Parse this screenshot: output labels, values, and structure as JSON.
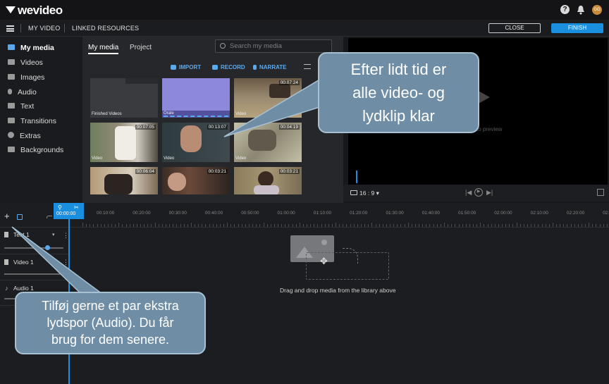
{
  "app": {
    "logo": "wevideo",
    "help_icon": "?",
    "avatar_initials": "GG"
  },
  "nav": {
    "my_video": "MY VIDEO",
    "linked_resources": "LINKED RESOURCES",
    "close": "CLOSE",
    "finish": "FINISH"
  },
  "sidebar": {
    "items": [
      {
        "label": "My media",
        "icon": "folder-icon"
      },
      {
        "label": "Videos",
        "icon": "film-icon"
      },
      {
        "label": "Images",
        "icon": "image-icon"
      },
      {
        "label": "Audio",
        "icon": "music-note-icon"
      },
      {
        "label": "Text",
        "icon": "text-icon"
      },
      {
        "label": "Transitions",
        "icon": "transitions-icon"
      },
      {
        "label": "Extras",
        "icon": "smiley-icon"
      },
      {
        "label": "Backgrounds",
        "icon": "backgrounds-icon"
      }
    ]
  },
  "library": {
    "tabs": [
      "My media",
      "Project"
    ],
    "search_placeholder": "Search my media",
    "import": "IMPORT",
    "record": "RECORD",
    "narrate": "NARRATE",
    "items": [
      {
        "label": "Finished Videos",
        "duration": ""
      },
      {
        "label": "Orale",
        "duration": ""
      },
      {
        "label": "Video",
        "duration": "00:07:24"
      },
      {
        "label": "Video",
        "duration": "00:07:05"
      },
      {
        "label": "Video",
        "duration": "00:13:07"
      },
      {
        "label": "Video",
        "duration": "00:04:19"
      },
      {
        "label": "",
        "duration": "00:06:04"
      },
      {
        "label": "",
        "duration": "00:03:21"
      },
      {
        "label": "",
        "duration": "00:03:21"
      }
    ]
  },
  "preview": {
    "hint": "to preview",
    "ratio": "16 : 9"
  },
  "timeline": {
    "playhead_time": "00:00:00",
    "ticks": [
      "00:10:00",
      "00:20:00",
      "00:30:00",
      "00:40:00",
      "00:50:00",
      "01:00:00",
      "01:10:00",
      "01:20:00",
      "01:30:00",
      "01:40:00",
      "01:50:00",
      "02:00:00",
      "02:10:00",
      "02:20:00",
      "02:3"
    ],
    "tracks": [
      "Text 1",
      "Video 1",
      "Audio 1"
    ],
    "drop_text": "Drag and drop media from the library above"
  },
  "callouts": {
    "top": [
      "Efter lidt tid er",
      "alle video- og",
      "lydklip klar"
    ],
    "bottom": [
      "Tilføj gerne et par ekstra",
      "lydspor (Audio). Du får",
      "brug for dem senere."
    ]
  },
  "colors": {
    "accent": "#1a8fe0",
    "callout_bg": "#6f8ea6"
  }
}
